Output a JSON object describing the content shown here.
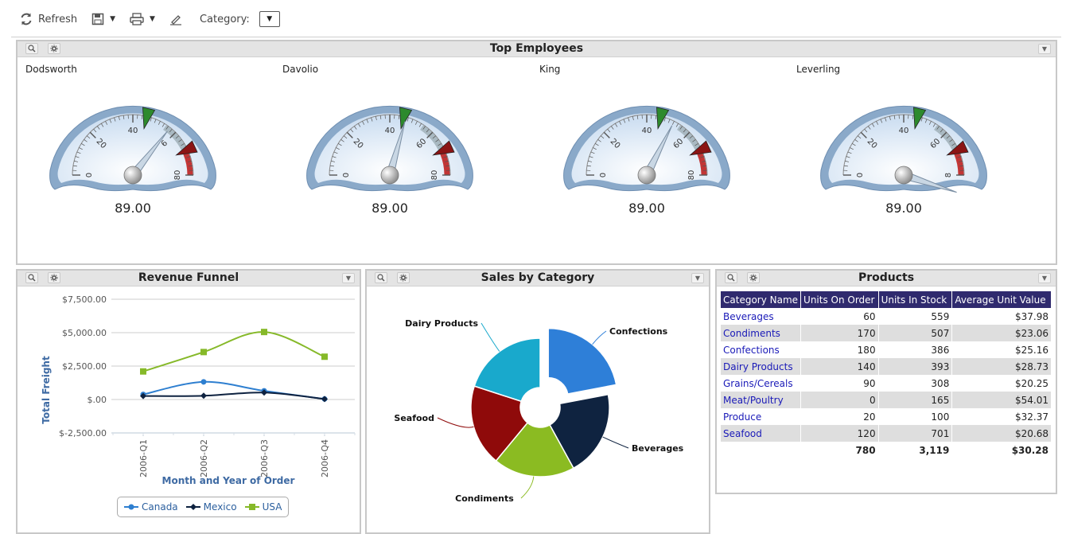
{
  "toolbar": {
    "refresh_label": "Refresh",
    "category_label": "Category:",
    "category_caret": "▼",
    "caret": "▼"
  },
  "header_controls": {
    "dropdown_glyph": "▼"
  },
  "top_employees": {
    "title": "Top Employees",
    "gauges": [
      {
        "name": "Dodsworth",
        "value": "89.00",
        "needle": 57,
        "ticks": [
          "0",
          "20",
          "40",
          "6",
          "80"
        ]
      },
      {
        "name": "Davolio",
        "value": "89.00",
        "needle": 47,
        "ticks": [
          "0",
          "20",
          "40",
          "60",
          "80"
        ]
      },
      {
        "name": "King",
        "value": "89.00",
        "needle": 52,
        "ticks": [
          "0",
          "20",
          "40",
          "60",
          "80"
        ]
      },
      {
        "name": "Leverling",
        "value": "89.00",
        "needle": 88,
        "ticks": [
          "0",
          "20",
          "40",
          "60",
          "8"
        ]
      }
    ]
  },
  "revenue_funnel": {
    "title": "Revenue Funnel",
    "chart_data": {
      "type": "line",
      "title": "Revenue Funnel",
      "xlabel": "Month and Year of Order",
      "ylabel": "Total Freight",
      "categories": [
        "2006-Q1",
        "2006-Q2",
        "2006-Q3",
        "2006-Q4"
      ],
      "yticks": [
        "$7,500.00",
        "$5,000.00",
        "$2,500.00",
        "$.00",
        "$-2,500.00"
      ],
      "ylim": [
        -2500,
        7500
      ],
      "legend": "bottom",
      "series": [
        {
          "name": "Canada",
          "color": "#2e7fd0",
          "values": [
            380,
            1320,
            650,
            40
          ]
        },
        {
          "name": "Mexico",
          "color": "#0e2240",
          "values": [
            260,
            280,
            520,
            40
          ]
        },
        {
          "name": "USA",
          "color": "#86b929",
          "values": [
            2100,
            3550,
            5050,
            3200
          ]
        }
      ]
    }
  },
  "sales_by_category": {
    "title": "Sales by Category",
    "chart_data": {
      "type": "pie",
      "title": "Sales by Category",
      "categories": [
        "Confections",
        "Beverages",
        "Condiments",
        "Seafood",
        "Dairy Products"
      ],
      "values": [
        22,
        20,
        19,
        19,
        20
      ],
      "colors": [
        "#2e7fd8",
        "#0f2340",
        "#8bbb22",
        "#8f0a0a",
        "#19a9cc"
      ],
      "exploded": "Confections"
    }
  },
  "products": {
    "title": "Products",
    "columns": [
      "Category Name",
      "Units On Order",
      "Units In Stock",
      "Average Unit Value"
    ],
    "rows": [
      [
        "Beverages",
        "60",
        "559",
        "$37.98"
      ],
      [
        "Condiments",
        "170",
        "507",
        "$23.06"
      ],
      [
        "Confections",
        "180",
        "386",
        "$25.16"
      ],
      [
        "Dairy Products",
        "140",
        "393",
        "$28.73"
      ],
      [
        "Grains/Cereals",
        "90",
        "308",
        "$20.25"
      ],
      [
        "Meat/Poultry",
        "0",
        "165",
        "$54.01"
      ],
      [
        "Produce",
        "20",
        "100",
        "$32.37"
      ],
      [
        "Seafood",
        "120",
        "701",
        "$20.68"
      ]
    ],
    "totals": [
      "",
      "780",
      "3,119",
      "$30.28"
    ]
  }
}
